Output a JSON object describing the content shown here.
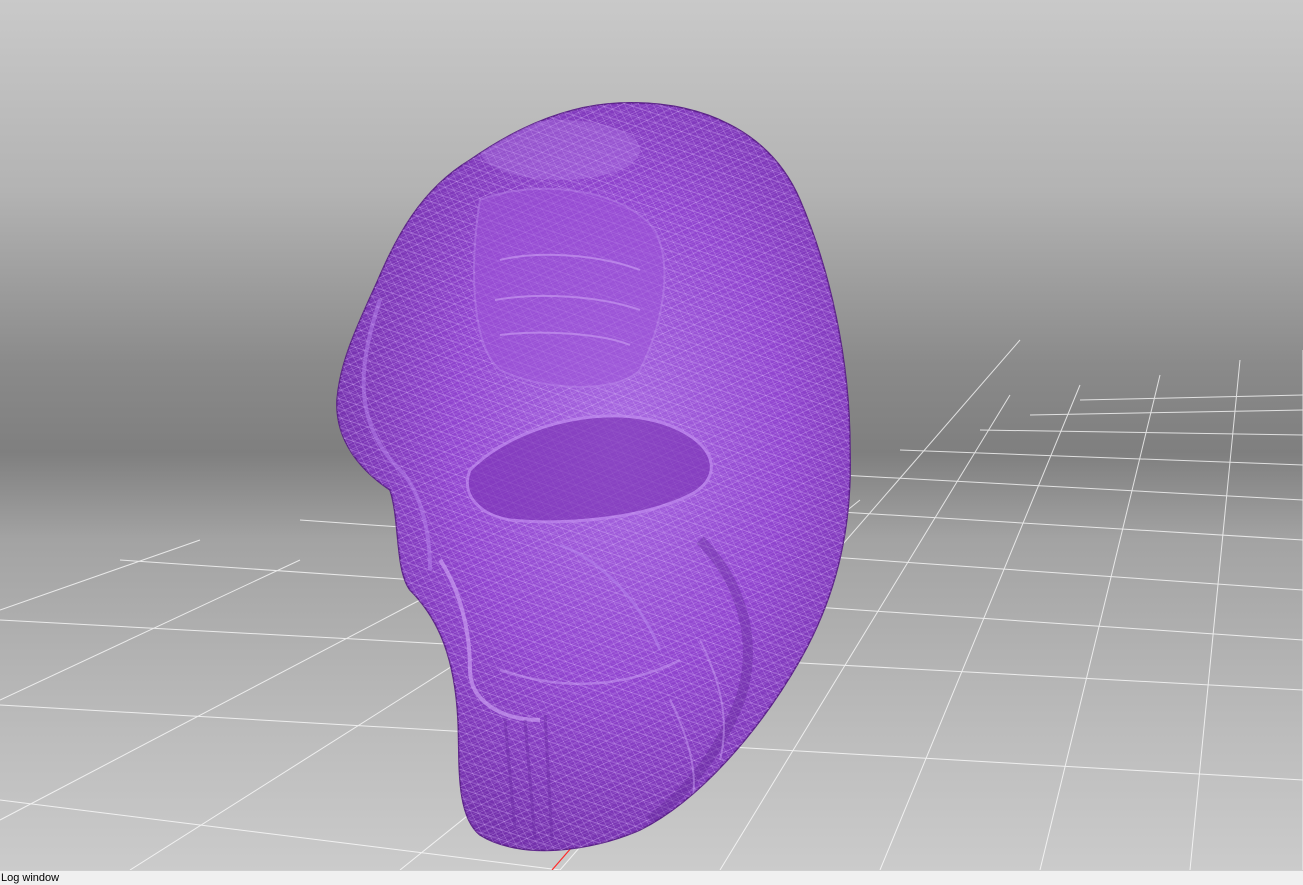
{
  "log_window": {
    "label": "Log window"
  },
  "viewport": {
    "background_top_color": "#c8c8c8",
    "background_horizon_color": "#7c7c7c",
    "floor_color": "#b9b9b9",
    "grid_color": "#ffffff",
    "model_color": "#8f3fc9",
    "wireframe_color": "#c89af0",
    "axis_x_color": "#ff2020"
  }
}
